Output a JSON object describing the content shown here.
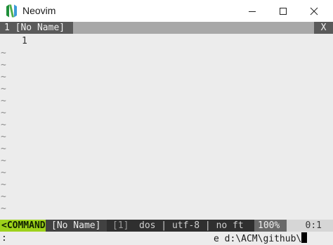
{
  "window": {
    "title": "Neovim",
    "icon": "neovim-logo-icon",
    "controls": [
      "minimize-icon",
      "maximize-icon",
      "close-icon"
    ]
  },
  "tabline": {
    "active_tab": "1 [No Name]",
    "close_label": "X"
  },
  "buffer": {
    "line_numbers": [
      "1"
    ],
    "tilde": "~"
  },
  "statusline": {
    "mode": "<COMMAND",
    "filename": "[No Name]",
    "buffer_number": "[1]",
    "file_info": "dos | utf-8 | no ft",
    "percent": "100%",
    "position": "0:1"
  },
  "cmdline": {
    "prefix": ":",
    "text": "e d:\\ACM\\github\\"
  },
  "colors": {
    "mode_accent": "#9dd11b",
    "editor_bg": "#ececec",
    "statusline_bg": "#2f2f2f"
  }
}
